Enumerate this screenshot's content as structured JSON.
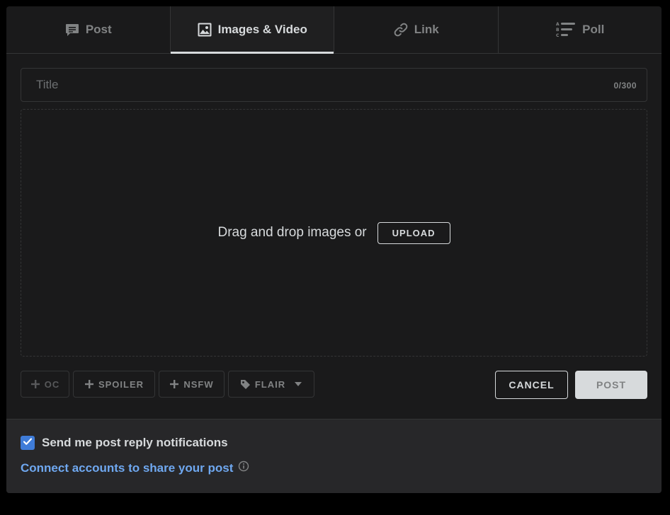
{
  "tabs": [
    {
      "label": "Post",
      "icon": "post-text-icon",
      "active": false
    },
    {
      "label": "Images & Video",
      "icon": "image-icon",
      "active": true
    },
    {
      "label": "Link",
      "icon": "link-icon",
      "active": false
    },
    {
      "label": "Poll",
      "icon": "poll-icon",
      "active": false
    }
  ],
  "title": {
    "placeholder": "Title",
    "value": "",
    "counter": "0/300"
  },
  "dropzone": {
    "text": "Drag and drop images or",
    "upload_label": "UPLOAD"
  },
  "tags": {
    "oc": "OC",
    "spoiler": "SPOILER",
    "nsfw": "NSFW",
    "flair": "FLAIR"
  },
  "actions": {
    "cancel_label": "CANCEL",
    "post_label": "POST"
  },
  "footer": {
    "notify_label": "Send me post reply notifications",
    "notify_checked": true,
    "connect_label": "Connect accounts to share your post"
  },
  "colors": {
    "background": "#1a1a1b",
    "accent_blue": "#3f7cd8",
    "link_blue": "#6fa8f0",
    "text": "#d7dadc"
  }
}
